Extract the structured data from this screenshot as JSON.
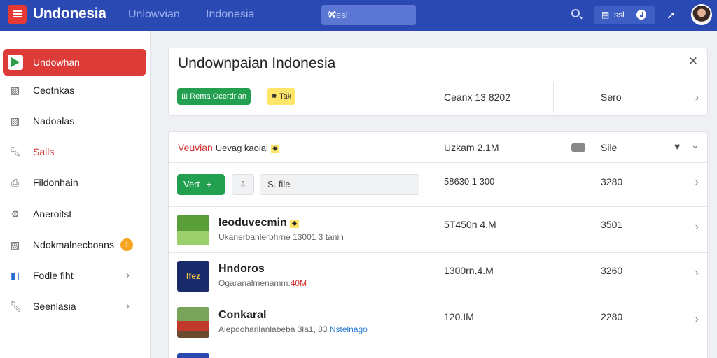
{
  "header": {
    "app_title": "Undonesia",
    "nav": [
      "Unlowvian",
      "Indonesia"
    ],
    "search": {
      "value": "Wesl",
      "clear": "✕"
    },
    "action_label": "ssl",
    "colors": {
      "bar": "#2a49b3",
      "accent": "#dc3b37"
    }
  },
  "sidebar": {
    "items": [
      {
        "label": "Undowhan",
        "icon": "play-store-icon",
        "active": true
      },
      {
        "label": "Ceotnkas",
        "icon": "image-icon"
      },
      {
        "label": "Nadoalas",
        "icon": "image-icon"
      },
      {
        "label": "Sails",
        "icon": "wrench-icon"
      },
      {
        "label": "Fildonhain",
        "icon": "printer-icon"
      },
      {
        "label": "Aneroitst",
        "icon": "gear-icon"
      },
      {
        "label": "Ndokmalnecboans",
        "icon": "image-icon",
        "badge": "!"
      },
      {
        "label": "Fodle fiht",
        "icon": "share-icon"
      },
      {
        "label": "Seenlasia",
        "icon": "wrench-icon"
      }
    ]
  },
  "panel": {
    "title": "Undownpaian Indonesia",
    "chip_green": "Rema Ocerdrian",
    "chip_yellow": "Tak",
    "col_a": "Ceanx 13 8202",
    "col_b": "Sero"
  },
  "list": {
    "header": {
      "title_red": "Veuvian",
      "title_rest": "Uevag kaoial",
      "size": "Uzkam 2.1M",
      "col": "Sile"
    },
    "toolbar": {
      "add_label": "Vert",
      "add_icon": "+",
      "filter_text": "S. file",
      "size": "58630 1 300",
      "count": "3280"
    },
    "rows": [
      {
        "title": "Ieoduvecmin",
        "sub": "Ukanerbanlerbhrne 13001 3 tanin",
        "sub_hi": "",
        "size": "5T450n 4.M",
        "count": "3501"
      },
      {
        "title": "Hndoros",
        "sub": "Ogaranalmenamm.",
        "sub_hi": "40M",
        "size": "1300rn.4.M",
        "count": "3260"
      },
      {
        "title": "Conkaral",
        "sub": "Alepdoharilanlabeba 3la1, 83",
        "sub_hi": "Nstelnago",
        "size": "120.IM",
        "count": "2280"
      }
    ]
  }
}
